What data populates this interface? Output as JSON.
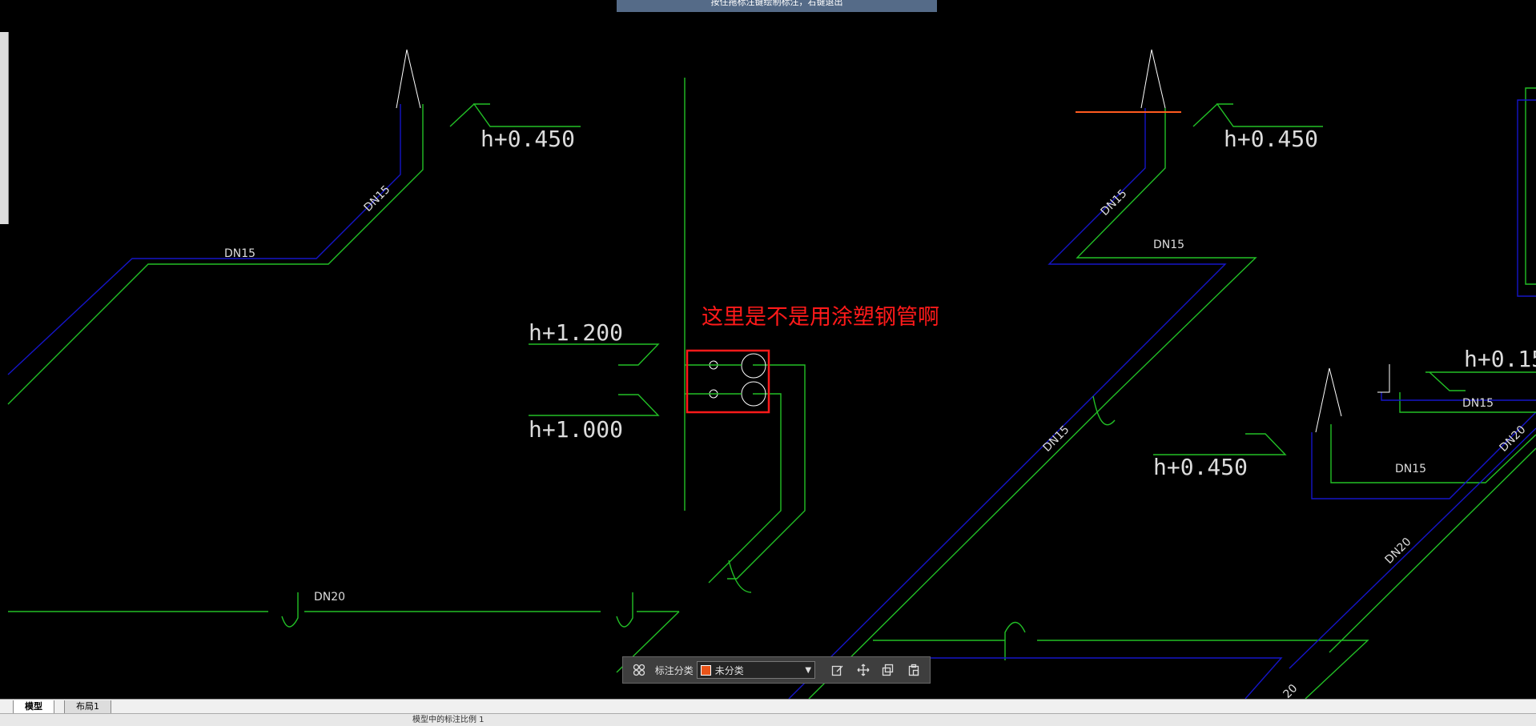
{
  "hint_bar": {
    "text": "按住拖标注键绘制标注，右键退出"
  },
  "drawing": {
    "annotation_note": "这里是不是用涂塑钢管啊",
    "elevations": {
      "e1": "h+0.450",
      "e2": "h+0.450",
      "e3": "h+1.200",
      "e4": "h+1.000",
      "e5": "h+0.450",
      "e6": "h+0.15"
    },
    "pipe_labels": {
      "p1": "DN15",
      "p2": "DN15",
      "p3": "DN15",
      "p4": "DN15",
      "p5": "DN15",
      "p6": "DN15",
      "p7": "DN15",
      "p8": "DN20",
      "p9": "DN20",
      "p10": "DN20",
      "p11": "20"
    },
    "colors": {
      "pipe_green": "#22c026",
      "pipe_blue": "#1515c8",
      "annotation_red": "#ff1a1a",
      "orange_line": "#ff5a1f"
    }
  },
  "toolbar": {
    "category_label": "标注分类",
    "category_value": "未分类",
    "swatch_color": "#e8541a",
    "icons": [
      "layout-grid-icon",
      "edit-icon",
      "move-icon",
      "copy-icon",
      "paste-icon"
    ]
  },
  "tabs": [
    {
      "label": "模型",
      "active": true
    },
    {
      "label": "布局1",
      "active": false
    }
  ],
  "status_bar": {
    "coords": "",
    "text": "模型中的标注比例 1"
  }
}
